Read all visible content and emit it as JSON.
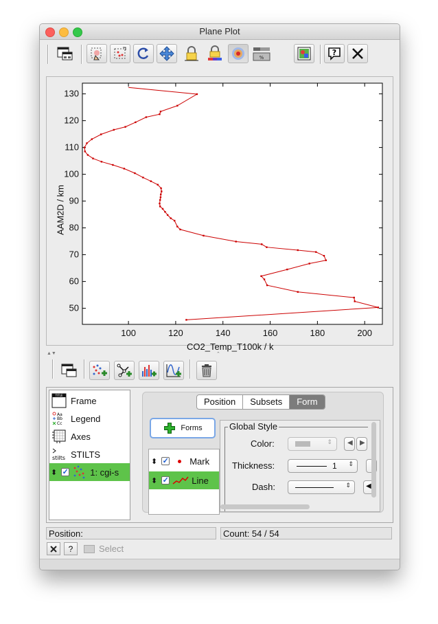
{
  "window": {
    "title": "Plane Plot"
  },
  "plot": {
    "xlabel": "CO2_Temp_T100k / k",
    "ylabel": "AAM2D / km"
  },
  "chart_data": {
    "type": "line",
    "xlabel": "CO2_Temp_T100k / k",
    "ylabel": "AAM2D / km",
    "xlim": [
      80.5,
      207.5
    ],
    "ylim": [
      44,
      134
    ],
    "xticks": [
      100,
      120,
      140,
      160,
      180,
      200
    ],
    "yticks": [
      50,
      60,
      70,
      80,
      90,
      100,
      110,
      120,
      130
    ],
    "grid": false,
    "series": [
      {
        "color": "#cc0000",
        "marker": "point",
        "x": [
          124.5,
          205.7,
          195.8,
          195.5,
          171.7,
          158.7,
          157.5,
          156.2,
          167.2,
          176.6,
          183.6,
          182.8,
          179.4,
          171.7,
          158.5,
          156.4,
          145.5,
          131.8,
          121.9,
          120.7,
          119.5,
          117.9,
          116.6,
          115.5,
          114.5,
          113.4,
          113.2,
          113.4,
          113.6,
          113.7,
          114.0,
          113.8,
          112.4,
          109.5,
          106.2,
          102.7,
          98.2,
          93.4,
          88.6,
          85.0,
          82.8,
          81.6,
          81.4,
          82.4,
          84.5,
          88.4,
          93.8,
          98.7,
          103.0,
          107.5,
          113.2,
          113.6,
          120.7,
          129.0
        ],
        "y": [
          45.7,
          50.3,
          52.6,
          54.0,
          56.1,
          58.6,
          60.8,
          62.0,
          64.5,
          66.7,
          67.9,
          69.6,
          71.0,
          71.7,
          72.8,
          73.9,
          74.9,
          77.1,
          79.4,
          80.5,
          82.7,
          83.6,
          84.8,
          86.0,
          87.1,
          88.0,
          89.1,
          90.4,
          91.4,
          92.5,
          93.6,
          94.8,
          96.1,
          97.4,
          98.8,
          100.4,
          102.1,
          103.5,
          104.7,
          105.9,
          107.2,
          108.5,
          110.0,
          111.6,
          113.1,
          114.9,
          116.6,
          117.7,
          119.4,
          121.3,
          122.4,
          123.4,
          125.6,
          129.9
        ]
      }
    ]
  },
  "top_line_point": {
    "x": 100.0,
    "y": 132.4
  },
  "layers": [
    {
      "label": "Frame",
      "icon": "frame-icon"
    },
    {
      "label": "Legend",
      "icon": "legend-icon"
    },
    {
      "label": "Axes",
      "icon": "axes-icon"
    },
    {
      "label": "STILTS",
      "icon": "stilts-icon"
    },
    {
      "label": "1: cgi-s",
      "icon": "scatter-layer-icon",
      "checked": true
    }
  ],
  "tabs": {
    "position": "Position",
    "subsets": "Subsets",
    "form": "Form",
    "active": "Form"
  },
  "forms_button": "Forms",
  "forms_list": [
    {
      "label": "Mark",
      "checked": true
    },
    {
      "label": "Line",
      "checked": true
    }
  ],
  "global_style": {
    "title": "Global Style",
    "color_label": "Color:",
    "thickness_label": "Thickness:",
    "thickness_value": "1",
    "dash_label": "Dash:"
  },
  "status": {
    "position": "Position:",
    "count": "Count: 54 / 54"
  },
  "select_label": "Select",
  "help_label": "?",
  "icons": [
    "window-icon",
    "zoom-icon",
    "zoom-region-icon",
    "replot-icon",
    "pan-icon",
    "lock-icon",
    "lock-aux-icon",
    "density-icon",
    "aux-scale-icon",
    "export-icon",
    "help-icon",
    "close-icon",
    "trash-icon"
  ]
}
